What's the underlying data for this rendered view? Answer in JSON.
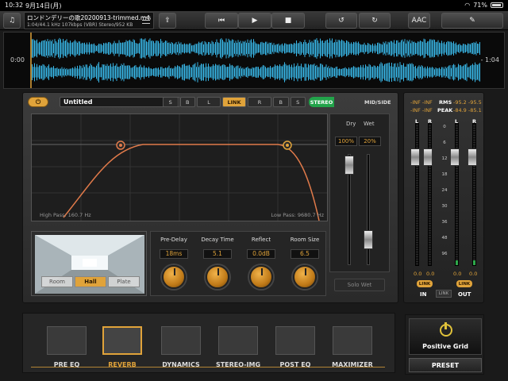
{
  "status": {
    "time": "10:32",
    "date": "9月14日(月)",
    "battery_text": "71%",
    "battery_level": 0.71
  },
  "file": {
    "name": "ロンドンデリーの歌20200913-trimmed.m4a",
    "meta": "1:04/44.1 kHz 107kbps (VBR) Stereo/952 KB"
  },
  "toolbar": {
    "format_label": "AAC"
  },
  "waveform": {
    "time_elapsed": "0:00",
    "time_remaining": "- 1:04"
  },
  "plugin": {
    "preset_name": "Untitled",
    "eq_bands": [
      "S",
      "B",
      "L",
      "LINK",
      "R",
      "B",
      "S"
    ],
    "eq_band_active": "LINK",
    "stereo_label": "STEREO",
    "midside_label": "MID/SIDE",
    "high_pass": "High Pass: 160.7 Hz",
    "low_pass": "Low Pass: 9680.7 Hz",
    "dry_label": "Dry",
    "wet_label": "Wet",
    "dry_value": "100%",
    "wet_value": "20%",
    "solo_wet": "Solo Wet",
    "rooms": [
      "Room",
      "Hall",
      "Plate"
    ],
    "room_active": "Hall",
    "params": [
      {
        "label": "Pre-Delay",
        "value": "18ms"
      },
      {
        "label": "Decay Time",
        "value": "5.1"
      },
      {
        "label": "Reflect",
        "value": "0.0dB"
      },
      {
        "label": "Room Size",
        "value": "6.5"
      }
    ]
  },
  "meters": {
    "rms_label": "RMS",
    "peak_label": "PEAK",
    "in_rms": "-INF -INF",
    "in_peak": "-INF -INF",
    "out_rms": "-95.2 -95.5",
    "out_peak": "-84.9 -85.1",
    "l": "L",
    "r": "R",
    "scale": [
      "0",
      "6",
      "12",
      "18",
      "24",
      "30",
      "36",
      "48",
      "96"
    ],
    "in_left": "0.0",
    "in_right": "0.0",
    "out_left": "0.0",
    "out_right": "0.0",
    "link": "LINK",
    "in_label": "IN",
    "out_label": "OUT"
  },
  "chain": {
    "modules": [
      "PRE EQ",
      "REVERB",
      "DYNAMICS",
      "STEREO-IMG",
      "POST EQ",
      "MAXIMIZER"
    ],
    "active": "REVERB"
  },
  "brand": {
    "name": "Positive Grid",
    "preset_button": "PRESET"
  },
  "colors": {
    "accent": "#e0a33a",
    "wave": "#38b6e6",
    "stereo_on": "#22a34a"
  }
}
